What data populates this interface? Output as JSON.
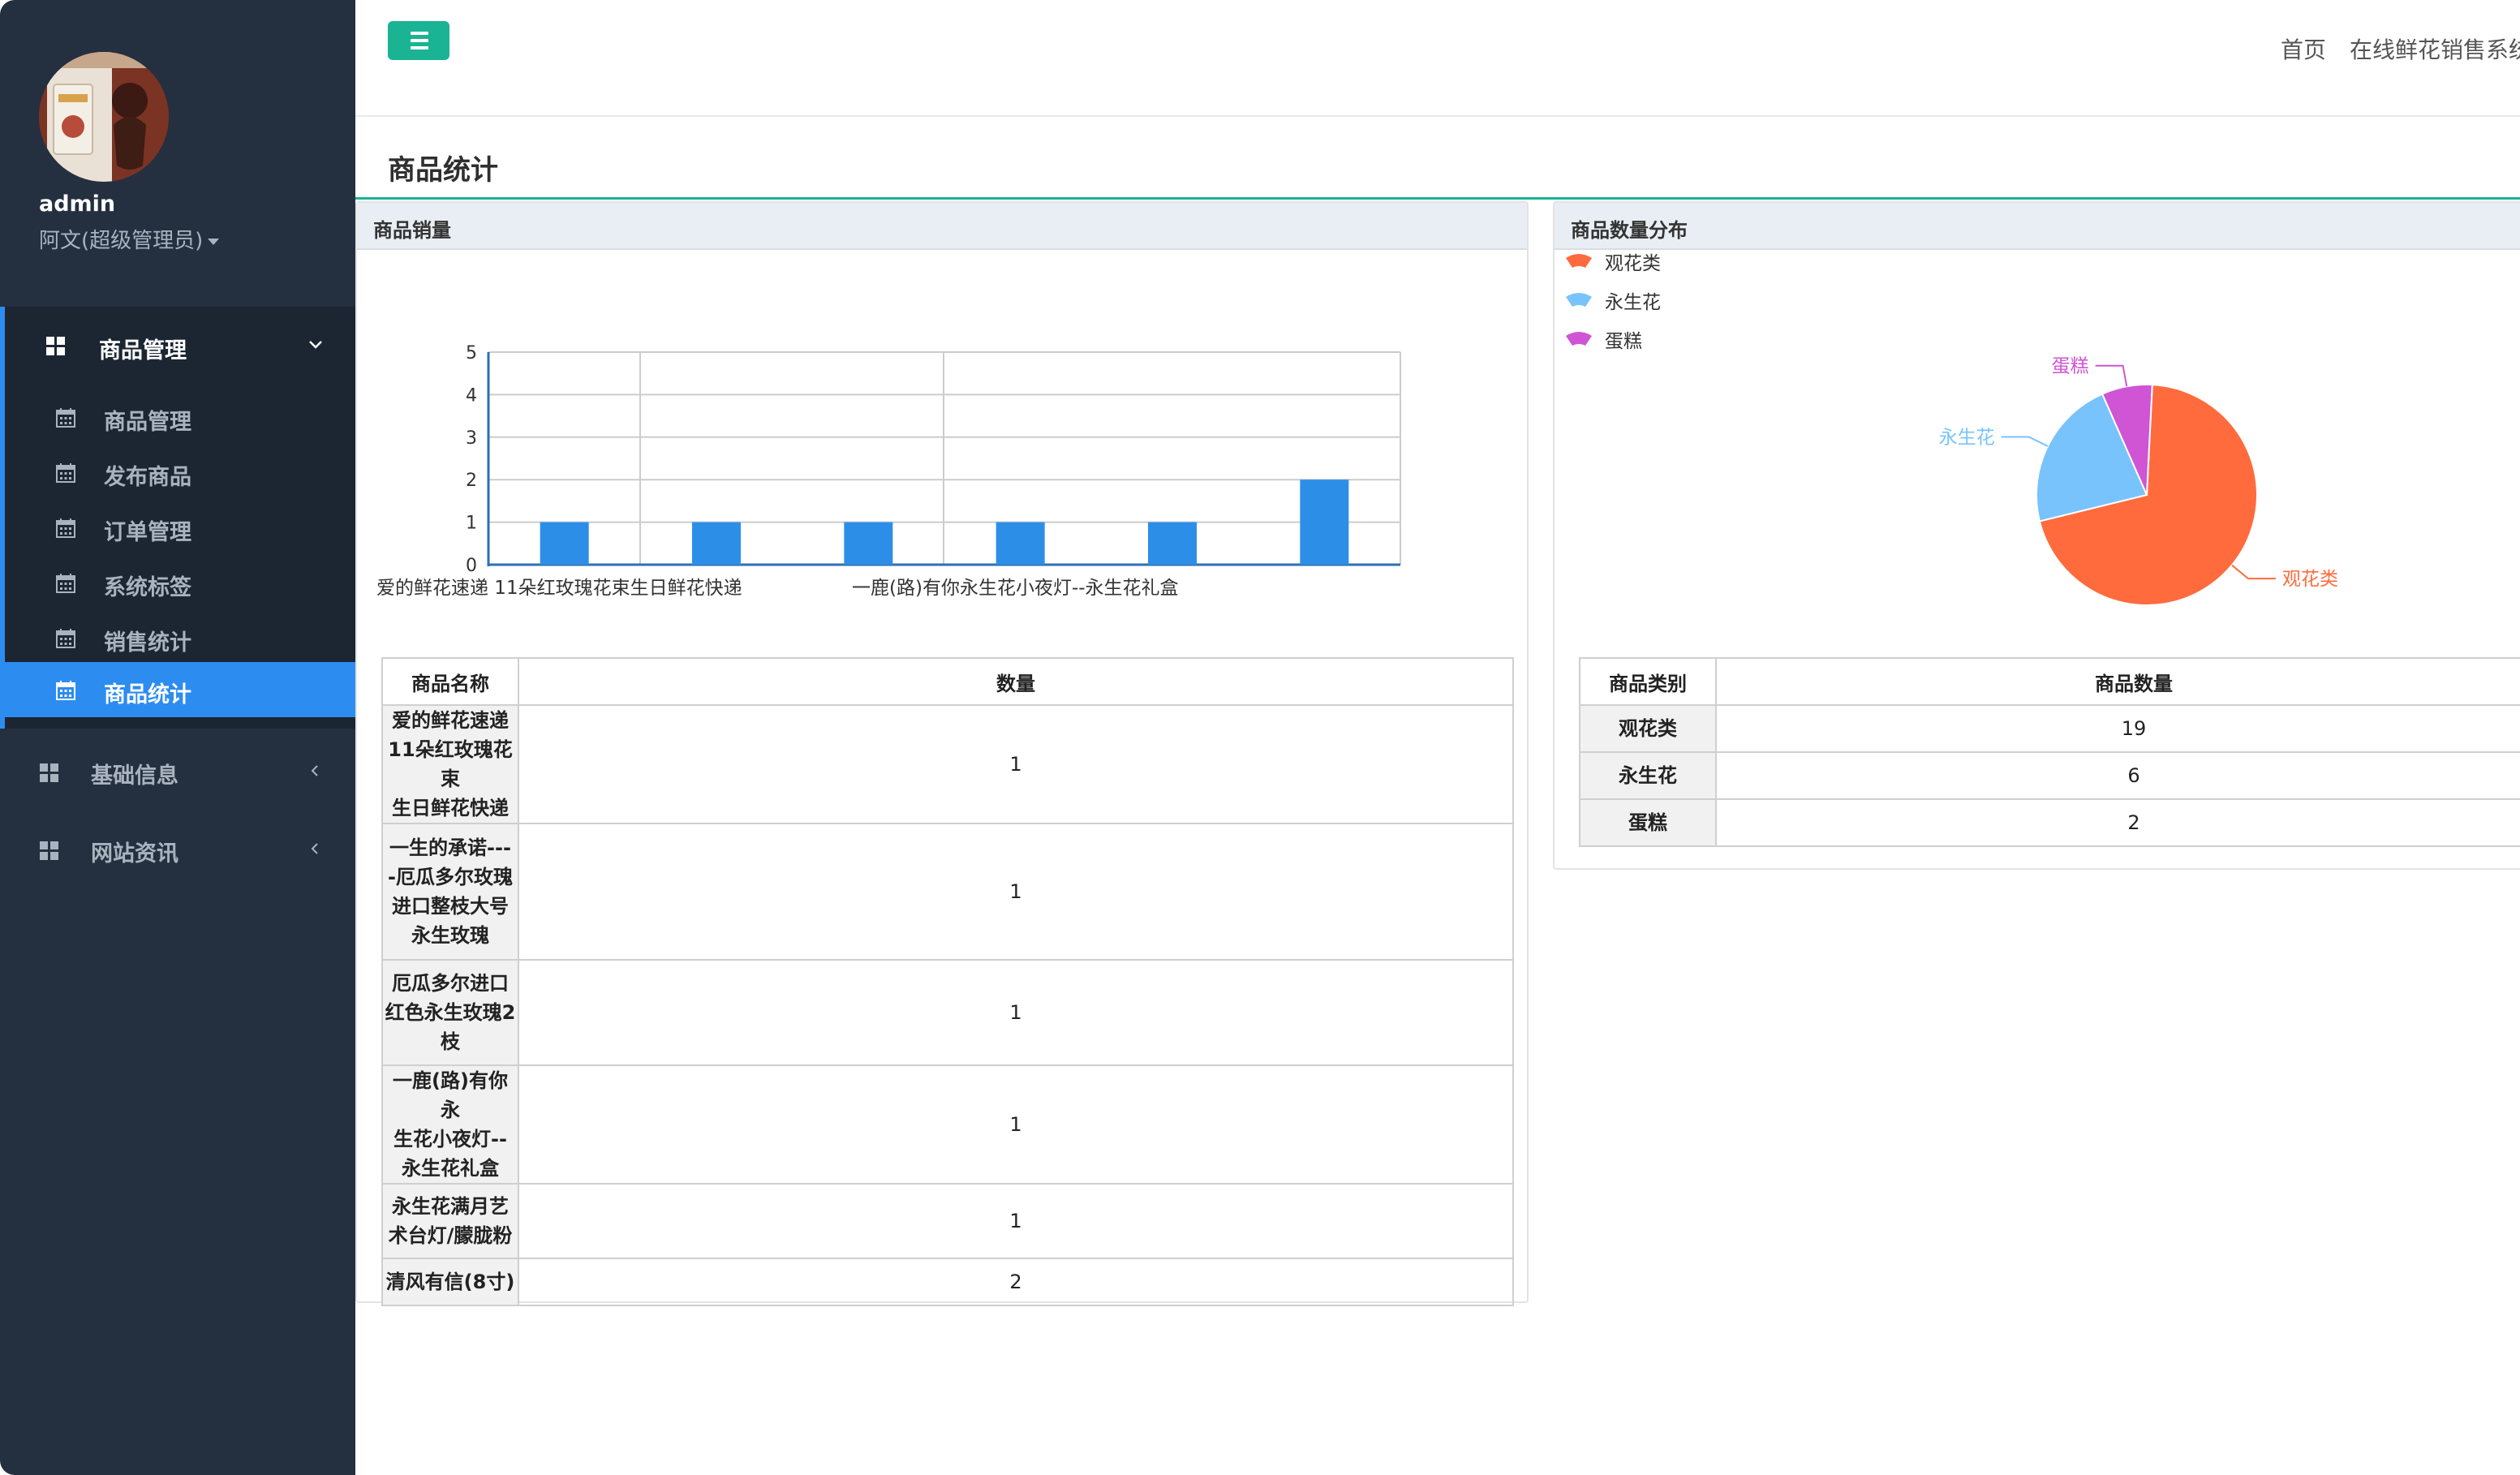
{
  "sidebar": {
    "user_name": "admin",
    "user_role": "阿文(超级管理员)",
    "group": {
      "label": "商品管理",
      "icon": "grid-icon",
      "items": [
        {
          "label": "商品管理",
          "icon": "calendar-icon"
        },
        {
          "label": "发布商品",
          "icon": "calendar-icon"
        },
        {
          "label": "订单管理",
          "icon": "calendar-icon"
        },
        {
          "label": "系统标签",
          "icon": "calendar-icon"
        },
        {
          "label": "销售统计",
          "icon": "calendar-icon"
        },
        {
          "label": "商品统计",
          "icon": "calendar-icon",
          "active": true
        }
      ]
    },
    "other_items": [
      {
        "label": "基础信息",
        "icon": "grid-icon"
      },
      {
        "label": "网站资讯",
        "icon": "grid-icon"
      }
    ]
  },
  "header": {
    "home_link": "首页",
    "system_link": "在线鲜花销售系统"
  },
  "page": {
    "title": "商品统计"
  },
  "sales_panel": {
    "title": "商品销量",
    "table_headers": [
      "商品名称",
      "数量"
    ],
    "rows": [
      {
        "name_lines": [
          "爱的鲜花速递",
          "11朵红玫瑰花束",
          "生日鲜花快递"
        ],
        "qty": "1"
      },
      {
        "name_lines": [
          "一生的承诺---",
          "-厄瓜多尔玫瑰",
          "进口整枝大号",
          "永生玫瑰"
        ],
        "qty": "1"
      },
      {
        "name_lines": [
          "厄瓜多尔进口",
          "红色永生玫瑰2",
          "枝"
        ],
        "qty": "1"
      },
      {
        "name_lines": [
          "一鹿(路)有你永",
          "生花小夜灯--",
          "永生花礼盒"
        ],
        "qty": "1"
      },
      {
        "name_lines": [
          "永生花满月艺",
          "术台灯/朦胧粉"
        ],
        "qty": "1"
      },
      {
        "name_lines": [
          "清风有信(8寸)"
        ],
        "qty": "2"
      }
    ]
  },
  "category_panel": {
    "title": "商品数量分布",
    "table_headers": [
      "商品类别",
      "商品数量"
    ],
    "rows": [
      {
        "category": "观花类",
        "count": "19"
      },
      {
        "category": "永生花",
        "count": "6"
      },
      {
        "category": "蛋糕",
        "count": "2"
      }
    ]
  },
  "chart_data": [
    {
      "type": "bar",
      "categories": [
        "爱的鲜花速递 11朵红玫瑰花束生日鲜花快递",
        "一生的承诺----厄瓜多尔玫瑰进口整枝大号永生玫瑰",
        "厄瓜多尔进口红色永生玫瑰2枝",
        "一鹿(路)有你永生花小夜灯--永生花礼盒",
        "永生花满月艺术台灯/朦胧粉",
        "清风有信(8寸)"
      ],
      "visible_xtick_labels": [
        "爱的鲜花速递 11朵红玫瑰花束生日鲜花快递",
        "一鹿(路)有你永生花小夜灯--永生花礼盒"
      ],
      "values": [
        1,
        1,
        1,
        1,
        1,
        2
      ],
      "yticks": [
        "0",
        "1",
        "2",
        "3",
        "4",
        "5"
      ],
      "ylim": [
        0,
        5
      ],
      "bar_color": "#2d8ee8",
      "grid": true
    },
    {
      "type": "pie",
      "labels": [
        "观花类",
        "永生花",
        "蛋糕"
      ],
      "values": [
        19,
        6,
        2
      ],
      "colors": [
        "#ff6b3d",
        "#78c3fb",
        "#cf55d4"
      ],
      "legend_position": "top-left"
    }
  ]
}
